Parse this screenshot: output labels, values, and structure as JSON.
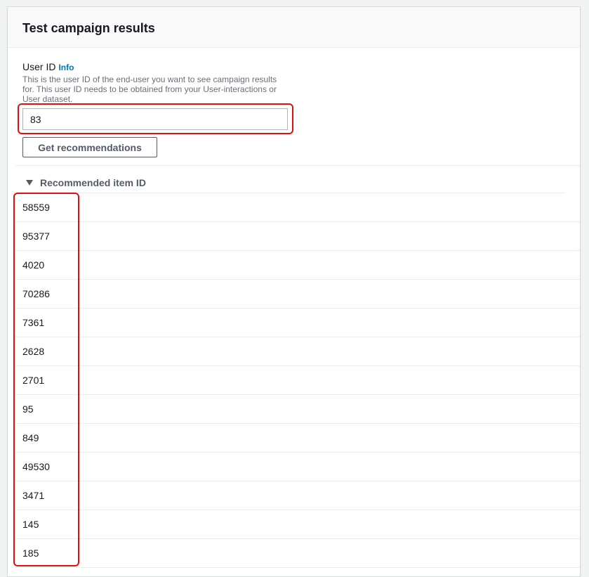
{
  "panel": {
    "title": "Test campaign results"
  },
  "form": {
    "user_id_label": "User ID",
    "info_link": "Info",
    "description": "This is the user ID of the end-user you want to see campaign results for. This user ID needs to be obtained from your User-interactions or User dataset.",
    "user_id_value": "83",
    "get_button_label": "Get recommendations"
  },
  "results": {
    "header_label": "Recommended item ID",
    "expanded": true,
    "items": [
      "58559",
      "95377",
      "4020",
      "70286",
      "7361",
      "2628",
      "2701",
      "95",
      "849",
      "49530",
      "3471",
      "145",
      "185"
    ]
  },
  "colors": {
    "highlight": "#e0110c",
    "link": "#0073bb"
  }
}
